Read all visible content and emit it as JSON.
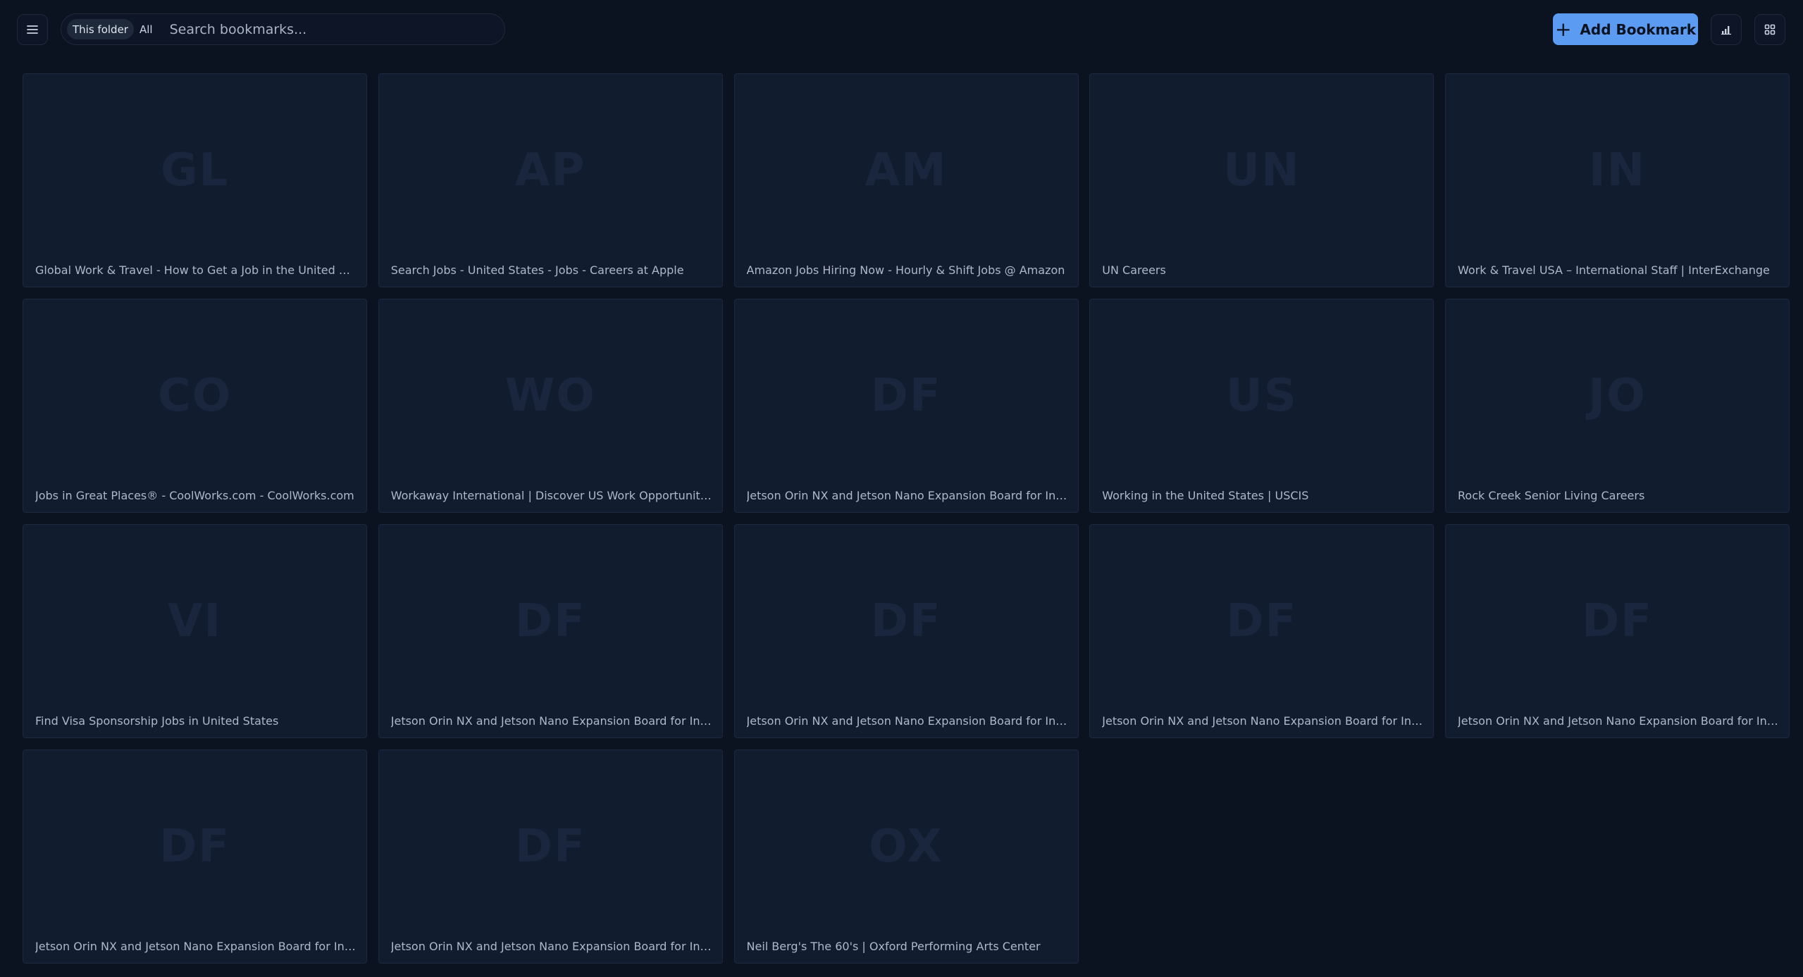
{
  "toolbar": {
    "scope_options": [
      "This folder",
      "All"
    ],
    "scope_selected": "This folder",
    "search_placeholder": "Search bookmarks...",
    "add_label": "Add Bookmark"
  },
  "bookmarks": [
    {
      "initials": "GL",
      "title": "Global Work & Travel - How to Get a Job in the United States"
    },
    {
      "initials": "AP",
      "title": "Search Jobs - United States - Jobs - Careers at Apple"
    },
    {
      "initials": "AM",
      "title": "Amazon Jobs Hiring Now - Hourly & Shift Jobs @ Amazon"
    },
    {
      "initials": "UN",
      "title": "UN Careers"
    },
    {
      "initials": "IN",
      "title": "Work & Travel USA – International Staff | InterExchange"
    },
    {
      "initials": "CO",
      "title": "Jobs in Great Places® - CoolWorks.com - CoolWorks.com"
    },
    {
      "initials": "WO",
      "title": "Workaway International | Discover US Work Opportunities – Workaway"
    },
    {
      "initials": "DF",
      "title": "Jetson Orin NX and Jetson Nano Expansion Board for Industrial"
    },
    {
      "initials": "US",
      "title": "Working in the United States | USCIS"
    },
    {
      "initials": "JO",
      "title": "Rock Creek Senior Living Careers"
    },
    {
      "initials": "VI",
      "title": "Find Visa Sponsorship Jobs in United States"
    },
    {
      "initials": "DF",
      "title": "Jetson Orin NX and Jetson Nano Expansion Board for Industrial"
    },
    {
      "initials": "DF",
      "title": "Jetson Orin NX and Jetson Nano Expansion Board for Industrial"
    },
    {
      "initials": "DF",
      "title": "Jetson Orin NX and Jetson Nano Expansion Board for Industrial"
    },
    {
      "initials": "DF",
      "title": "Jetson Orin NX and Jetson Nano Expansion Board for Industrial"
    },
    {
      "initials": "DF",
      "title": "Jetson Orin NX and Jetson Nano Expansion Board for Industrial"
    },
    {
      "initials": "DF",
      "title": "Jetson Orin NX and Jetson Nano Expansion Board for Industrial"
    },
    {
      "initials": "OX",
      "title": "Neil Berg's The 60's | Oxford Performing Arts Center"
    }
  ],
  "colors": {
    "background": "#0b1220",
    "card": "#121c2f",
    "accent": "#5b9cf2"
  },
  "icons": {
    "menu": "hamburger-icon",
    "add": "plus-icon",
    "stats": "bar-chart-icon",
    "view": "grid-icon"
  }
}
